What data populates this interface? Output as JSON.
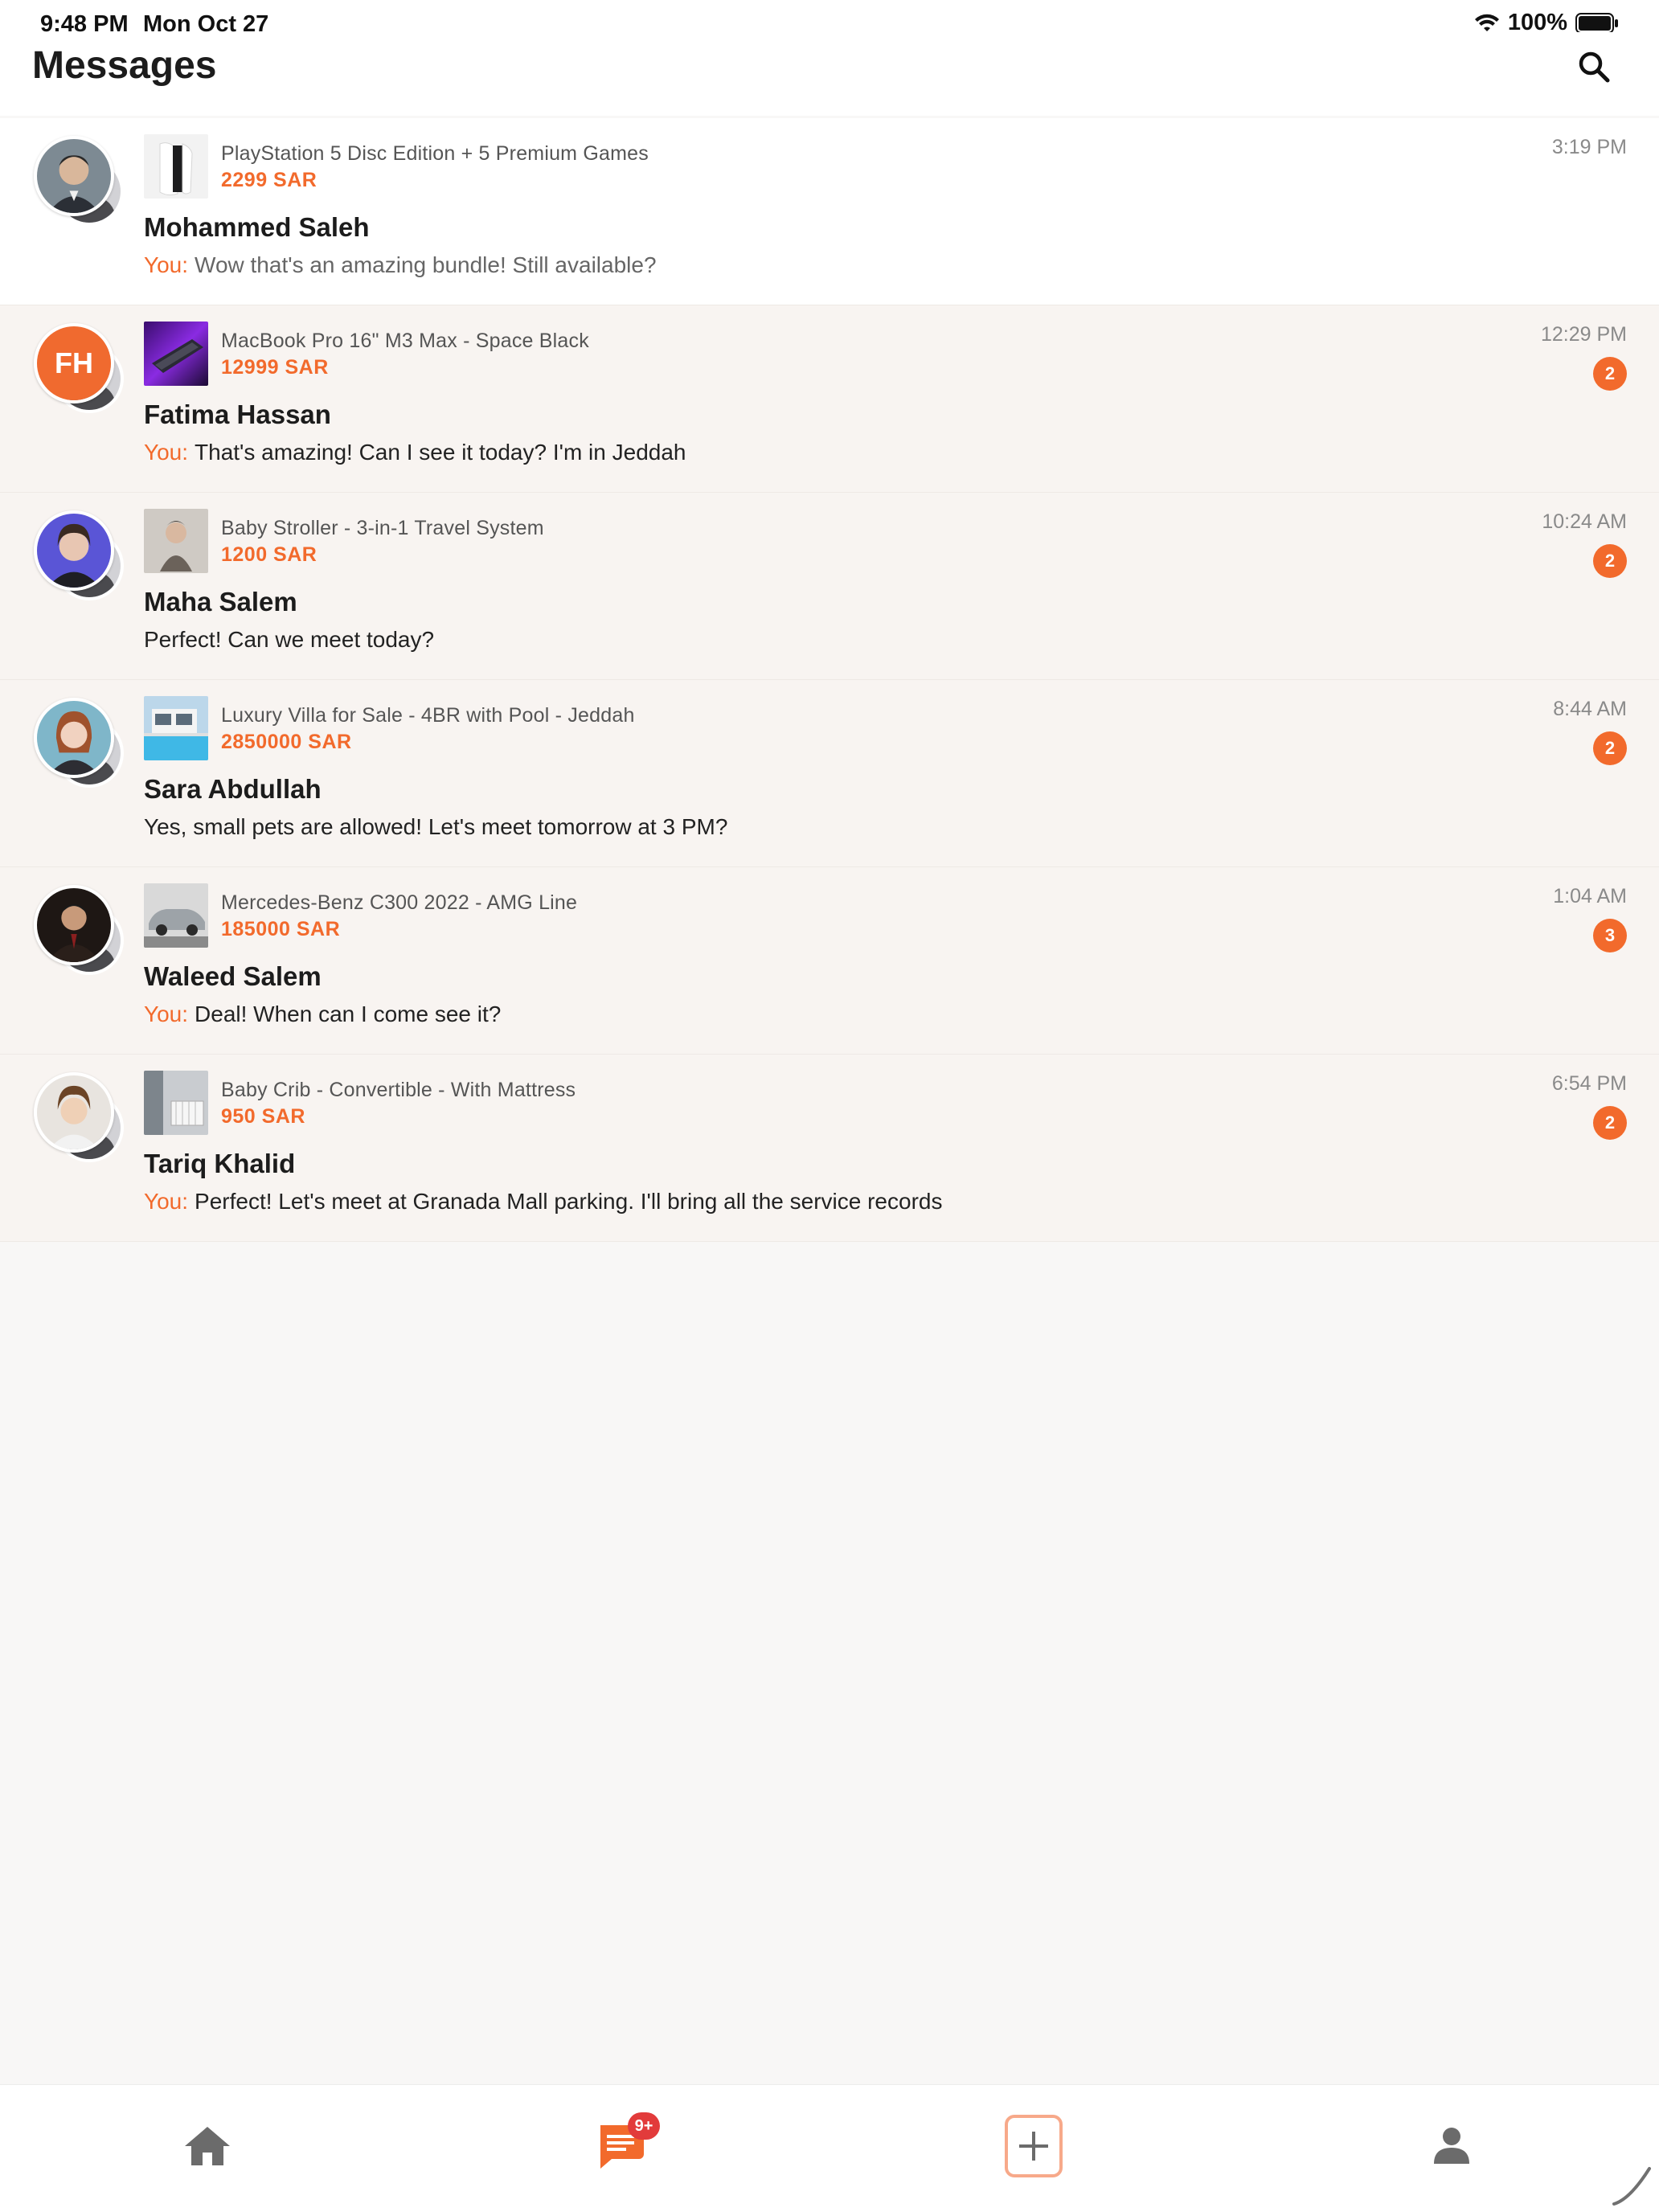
{
  "status_bar": {
    "time": "9:48 PM",
    "date": "Mon Oct 27",
    "battery": "100%"
  },
  "header": {
    "title": "Messages",
    "search_icon": "search-icon"
  },
  "conversations": [
    {
      "name": "Mohammed Saleh",
      "listing_title": "PlayStation 5 Disc Edition + 5 Premium Games",
      "price": "2299 SAR",
      "you_prefix": "You:",
      "message": "Wow that's an amazing bundle! Still available?",
      "time": "3:19 PM",
      "unread": ""
    },
    {
      "name": "Fatima Hassan",
      "initials": "FH",
      "listing_title": "MacBook Pro 16\" M3 Max - Space Black",
      "price": "12999 SAR",
      "you_prefix": "You:",
      "message": "That's amazing! Can I see it today? I'm in Jeddah",
      "time": "12:29 PM",
      "unread": "2"
    },
    {
      "name": "Maha Salem",
      "listing_title": "Baby Stroller - 3-in-1 Travel System",
      "price": "1200 SAR",
      "you_prefix": "",
      "message": "Perfect! Can we meet today?",
      "time": "10:24 AM",
      "unread": "2"
    },
    {
      "name": "Sara Abdullah",
      "listing_title": "Luxury Villa for Sale - 4BR with Pool - Jeddah",
      "price": "2850000 SAR",
      "you_prefix": "",
      "message": "Yes, small pets are allowed! Let's meet tomorrow at 3 PM?",
      "time": "8:44 AM",
      "unread": "2"
    },
    {
      "name": "Waleed Salem",
      "listing_title": "Mercedes-Benz C300 2022 - AMG Line",
      "price": "185000 SAR",
      "you_prefix": "You:",
      "message": "Deal! When can I come see it?",
      "time": "1:04 AM",
      "unread": "3"
    },
    {
      "name": "Tariq Khalid",
      "listing_title": "Baby Crib - Convertible - With Mattress",
      "price": "950 SAR",
      "you_prefix": "You:",
      "message": "Perfect! Let's meet at Granada Mall parking. I'll bring all the service records",
      "time": "6:54 PM",
      "unread": "2"
    }
  ],
  "bottom_nav": {
    "items": [
      {
        "icon": "home-icon"
      },
      {
        "icon": "chat-icon",
        "badge": "9+"
      },
      {
        "icon": "add-icon"
      },
      {
        "icon": "profile-icon"
      }
    ]
  },
  "colors": {
    "accent": "#f26a2c",
    "badge_red": "#e23b3b",
    "unread_bg": "#f8f4f1"
  }
}
